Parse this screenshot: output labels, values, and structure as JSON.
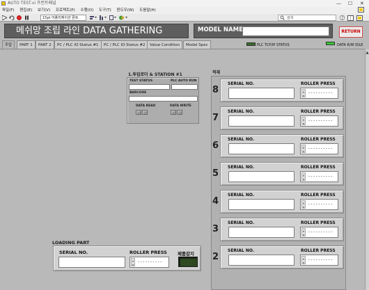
{
  "window": {
    "title": "AUTO TEST.vi 프런트패널",
    "controls": [
      "—",
      "☐",
      "✕"
    ]
  },
  "menu": {
    "items": [
      "파일(F)",
      "편집(E)",
      "보기(V)",
      "프로젝트(P)",
      "수행(O)",
      "도구(T)",
      "윈도우(W)",
      "도움말(H)"
    ]
  },
  "toolbar": {
    "font_selector": "15pt 어플리케이션 폰트",
    "search_placeholder": "검색"
  },
  "header": {
    "title": "메쉬망 조립 라인  DATA GATHERING",
    "model_name_label": "MODEL NAME",
    "model_name_value": "",
    "return_label": "RETURN"
  },
  "tabs": [
    {
      "label": "주압",
      "active": true
    },
    {
      "label": "PART 1",
      "active": false
    },
    {
      "label": "PART 2",
      "active": false
    },
    {
      "label": "PC / PLC IO Status #1",
      "active": false
    },
    {
      "label": "PC / PLC IO Status #2",
      "active": false
    },
    {
      "label": "Value Condition",
      "active": false
    },
    {
      "label": "Model Spec",
      "active": false
    }
  ],
  "indicators": {
    "plc_status_label": "PLC TCP/IP STATUS",
    "plc_status_color": "#3a6a2a",
    "data_rw_label": "DATA R/W IDLE",
    "data_rw_color": "#37c837"
  },
  "station1": {
    "title": "1.투입로더 & STATION #1",
    "test_status_label": "TEST STATUS",
    "plc_auto_run_label": "PLC AUTO RUN",
    "barcode_label": "BARCODE",
    "data_read_label": "DATA READ",
    "data_write_label": "DATA WRITE"
  },
  "stack": {
    "label": "적재",
    "slots": [
      {
        "number": "8",
        "serial_label": "SERIAL NO.",
        "serial_value": "",
        "roller_label": "ROLLER PRESS",
        "roller_value": "----------"
      },
      {
        "number": "7",
        "serial_label": "SERIAL NO.",
        "serial_value": "",
        "roller_label": "ROLLER PRESS",
        "roller_value": "----------"
      },
      {
        "number": "6",
        "serial_label": "SERIAL NO.",
        "serial_value": "",
        "roller_label": "ROLLER PRESS",
        "roller_value": "----------"
      },
      {
        "number": "5",
        "serial_label": "SERIAL NO.",
        "serial_value": "",
        "roller_label": "ROLLER PRESS",
        "roller_value": "----------"
      },
      {
        "number": "4",
        "serial_label": "SERIAL NO.",
        "serial_value": "",
        "roller_label": "ROLLER PRESS",
        "roller_value": "----------"
      },
      {
        "number": "3",
        "serial_label": "SERIAL NO.",
        "serial_value": "",
        "roller_label": "ROLLER PRESS",
        "roller_value": "----------"
      },
      {
        "number": "2",
        "serial_label": "SERIAL NO.",
        "serial_value": "",
        "roller_label": "ROLLER PRESS",
        "roller_value": "----------"
      }
    ]
  },
  "loading_part": {
    "title": "LOADING PART",
    "serial_label": "SERIAL NO.",
    "serial_value": "",
    "roller_label": "ROLLER PRESS",
    "roller_value": "----------",
    "detect_label": "제품감지",
    "detect_color": "#2f4a22"
  }
}
